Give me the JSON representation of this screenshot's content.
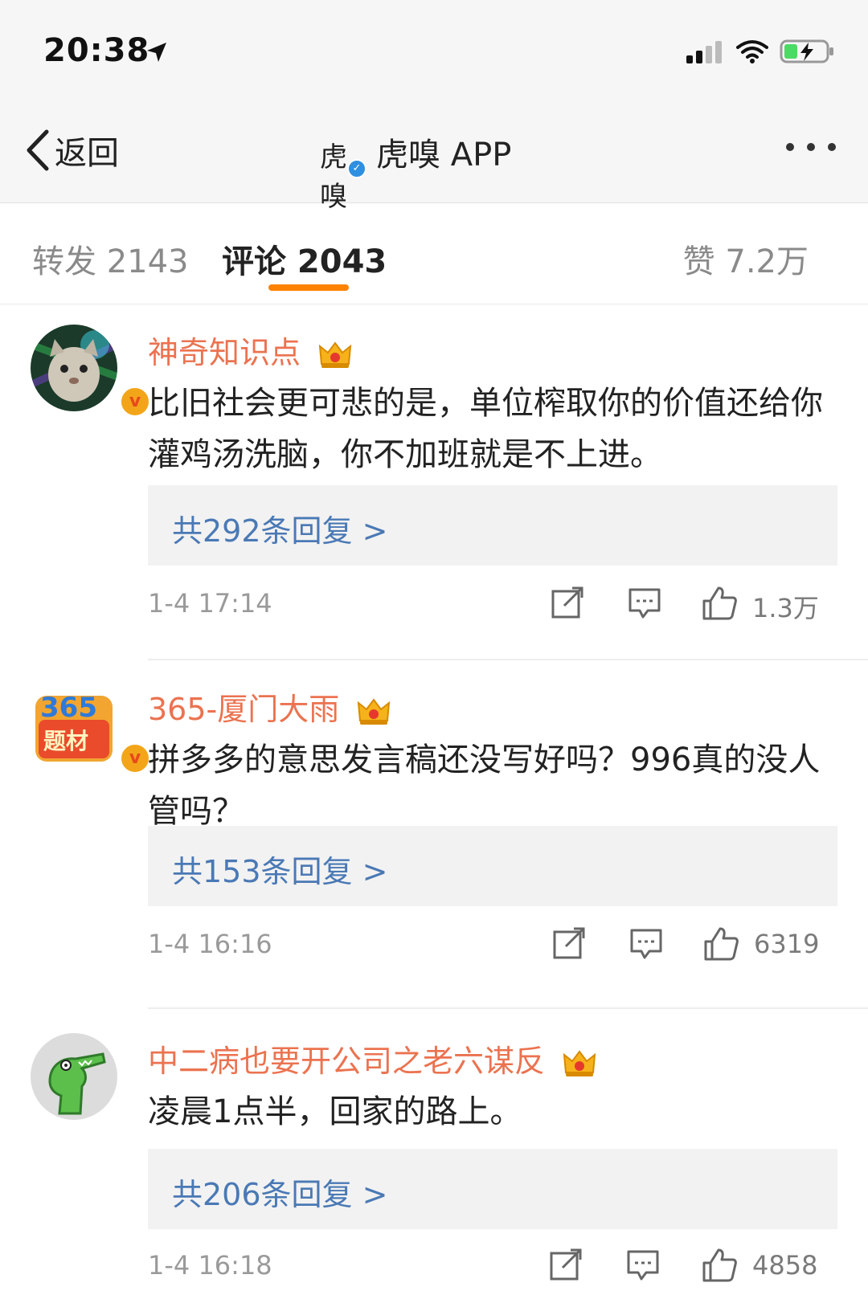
{
  "status_bar": {
    "time": "20:38"
  },
  "nav": {
    "back_label": "返回",
    "logo_text": "虎嗅",
    "title": "虎嗅 APP"
  },
  "tabs": [
    {
      "label": "转发 2143"
    },
    {
      "label": "评论 2043"
    },
    {
      "label": "赞 7.2万"
    }
  ],
  "comments": [
    {
      "username": "神奇知识点",
      "text": "比旧社会更可悲的是，单位榨取你的价值还给你灌鸡汤洗脑，你不加班就是不上进。",
      "replies": "共292条回复 >",
      "date": "1-4 17:14",
      "likes": "1.3万"
    },
    {
      "username": "365-厦门大雨",
      "text": "拼多多的意思发言稿还没写好吗？996真的没人管吗？",
      "replies": "共153条回复 >",
      "date": "1-4 16:16",
      "likes": "6319",
      "avatar_text": "365",
      "avatar_sub": "题材"
    },
    {
      "username": "中二病也要开公司之老六谋反",
      "text": "凌晨1点半，回家的路上。",
      "replies": "共206条回复 >",
      "date": "1-4 16:18",
      "likes": "4858"
    }
  ],
  "colors": {
    "accent": "#ff8200",
    "username": "#eb7350",
    "link": "#4a79b5"
  }
}
